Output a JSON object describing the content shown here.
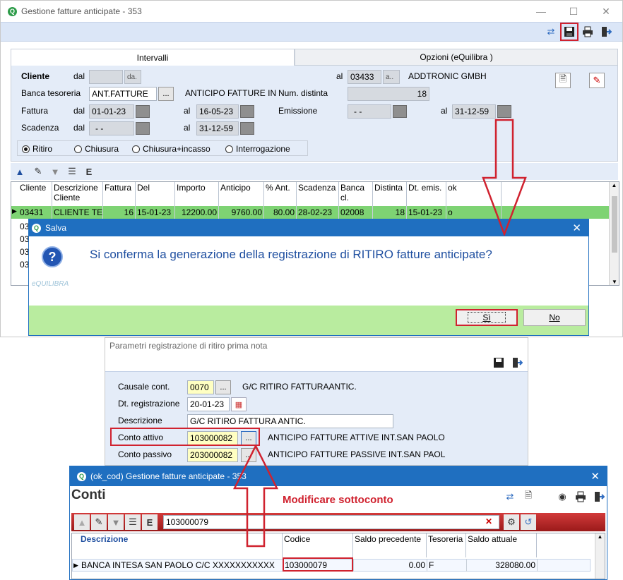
{
  "main_window": {
    "title": "Gestione fatture anticipate - 353",
    "tabs": [
      {
        "label": "Intervalli"
      },
      {
        "label": "Opzioni (eQuilibra )"
      }
    ],
    "filters": {
      "cliente_label": "Cliente",
      "dal_label": "dal",
      "al_label": "al",
      "cliente_dal_btn": "da.",
      "cliente_al_value": "03433",
      "cliente_al_btn": "a..",
      "cliente_name": "ADDTRONIC GMBH",
      "banca_label": "Banca tesoreria",
      "banca_value": "ANT.FATTURE",
      "banca_btn": "...",
      "banca_desc": "ANTICIPO FATTURE IN",
      "num_distinta_label": "Num. distinta",
      "num_distinta_value": "18",
      "fattura_label": "Fattura",
      "fattura_dal": "01-01-23",
      "fattura_al": "16-05-23",
      "emissione_label": "Emissione",
      "emissione_dal": "- -",
      "emissione_al": "31-12-59",
      "scadenza_label": "Scadenza",
      "scadenza_dal": "- -",
      "scadenza_al": "31-12-59"
    },
    "radios": [
      {
        "label": "Ritiro",
        "selected": true
      },
      {
        "label": "Chiusura",
        "selected": false
      },
      {
        "label": "Chiusura+incasso",
        "selected": false
      },
      {
        "label": "Interrogazione",
        "selected": false
      }
    ],
    "grid": {
      "headers": [
        "Cliente",
        "Descrizione Cliente",
        "Fattura",
        "Del",
        "Importo",
        "Anticipo",
        "% Ant.",
        "Scadenza",
        "Banca cl.",
        "Distinta",
        "Dt. emis.",
        "ok"
      ],
      "row": [
        "03431",
        "CLIENTE TE",
        "16",
        "15-01-23",
        "12200.00",
        "9760.00",
        "80.00",
        "28-02-23",
        "02008",
        "18",
        "15-01-23",
        "o"
      ],
      "partial_rows": [
        "03",
        "03",
        "03",
        "03"
      ]
    }
  },
  "confirm_dialog": {
    "title": "Salva",
    "message": "Si conferma la generazione della registrazione di RITIRO fatture anticipate?",
    "brand": "eQUILIBRA",
    "yes_label": "Sì",
    "no_label": "No"
  },
  "params_window": {
    "title": "Parametri registrazione di ritiro prima nota",
    "causale_label": "Causale cont.",
    "causale_value": "0070",
    "causale_desc": "G/C RITIRO FATTURAANTIC.",
    "dt_reg_label": "Dt. registrazione",
    "dt_reg_value": "20-01-23",
    "descrizione_label": "Descrizione",
    "descrizione_value": "G/C RITIRO FATTURA ANTIC.",
    "conto_attivo_label": "Conto attivo",
    "conto_attivo_value": "103000082",
    "conto_attivo_desc": "ANTICIPO FATTURE ATTIVE INT.SAN PAOLO",
    "conto_passivo_label": "Conto passivo",
    "conto_passivo_value": "203000082",
    "conto_passivo_desc": "ANTICIPO FATTURE PASSIVE INT.SAN PAOL",
    "dots": "..."
  },
  "conti_window": {
    "title": "(ok_cod) Gestione fatture anticipate - 353",
    "heading": "Conti",
    "annotation": "Modificare sottoconto",
    "search_value": "103000079",
    "headers": [
      "Descrizione",
      "Codice",
      "Saldo precedente",
      "Tesoreria",
      "Saldo attuale"
    ],
    "row": [
      "BANCA INTESA SAN PAOLO C/C XXXXXXXXXXX",
      "103000079",
      "0.00",
      "F",
      "328080.00"
    ]
  },
  "colors": {
    "accent_red": "#d0222f",
    "dialog_blue": "#1f6fc0",
    "row_green": "#7ed373",
    "footer_green": "#b9ec9f",
    "window_header_blue": "#1f6fc0"
  }
}
